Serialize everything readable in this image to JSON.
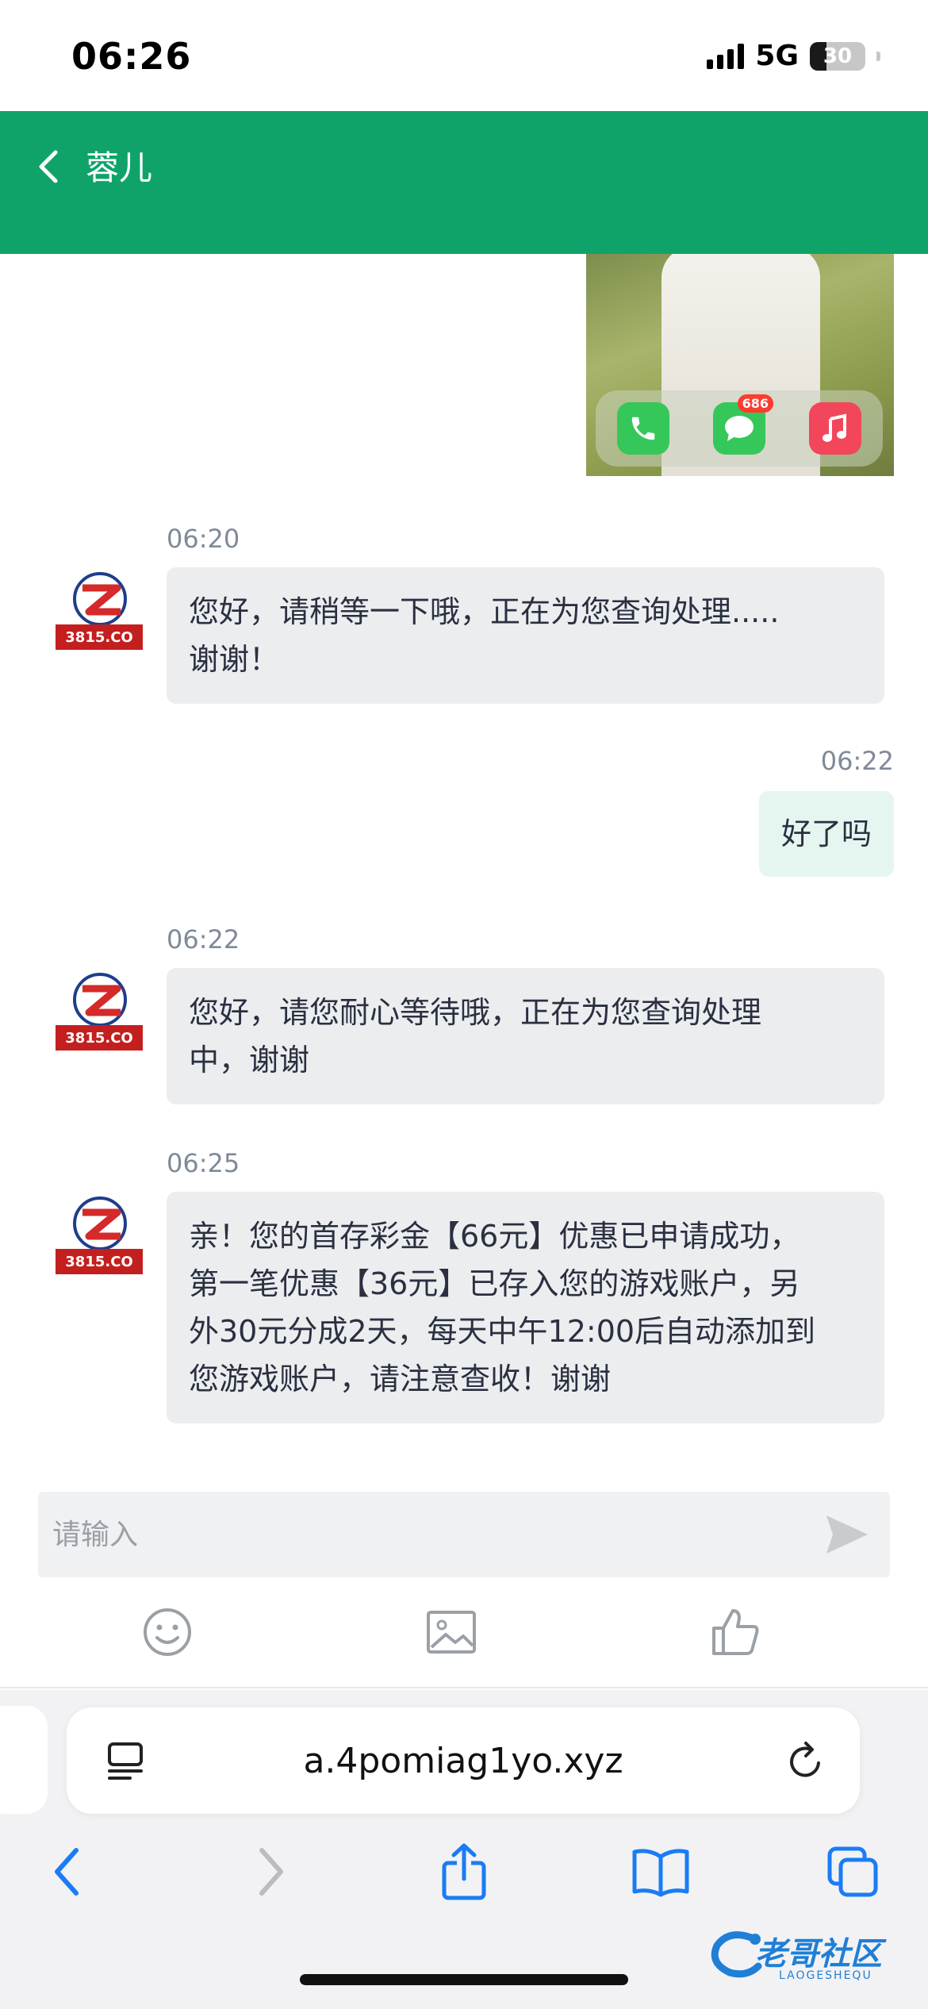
{
  "status_bar": {
    "time": "06:26",
    "network": "5G",
    "battery": "30",
    "battery_level": 0.3
  },
  "header": {
    "title": "蓉儿"
  },
  "image_message": {
    "app_badge": "686"
  },
  "messages": [
    {
      "side": "left",
      "time": "06:20",
      "lines": [
        "您好，请稍等一下哦，正在为您查询处理.....",
        "谢谢！"
      ]
    },
    {
      "side": "right",
      "time": "06:22",
      "lines": [
        "好了吗"
      ]
    },
    {
      "side": "left",
      "time": "06:22",
      "lines": [
        "您好，请您耐心等待哦，正在为您查询处理",
        "中，谢谢"
      ]
    },
    {
      "side": "left",
      "time": "06:25",
      "lines": [
        "亲！您的首存彩金【66元】优惠已申请成功，",
        "第一笔优惠【36元】已存入您的游戏账户，另",
        "外30元分成2天，每天中午12:00后自动添加到",
        "您游戏账户，请注意查收！谢谢"
      ]
    }
  ],
  "avatar": {
    "text": "3815.CO"
  },
  "input": {
    "placeholder": "请输入"
  },
  "browser": {
    "url": "a.4pomiag1yo.xyz"
  },
  "watermark": {
    "text": "老哥社区",
    "sub": "LAOGESHEQU"
  },
  "colors": {
    "header": "#0fa36a",
    "left_bubble": "#ebedef",
    "right_bubble": "#e5f6f0",
    "ios_blue": "#1a7cf5"
  }
}
